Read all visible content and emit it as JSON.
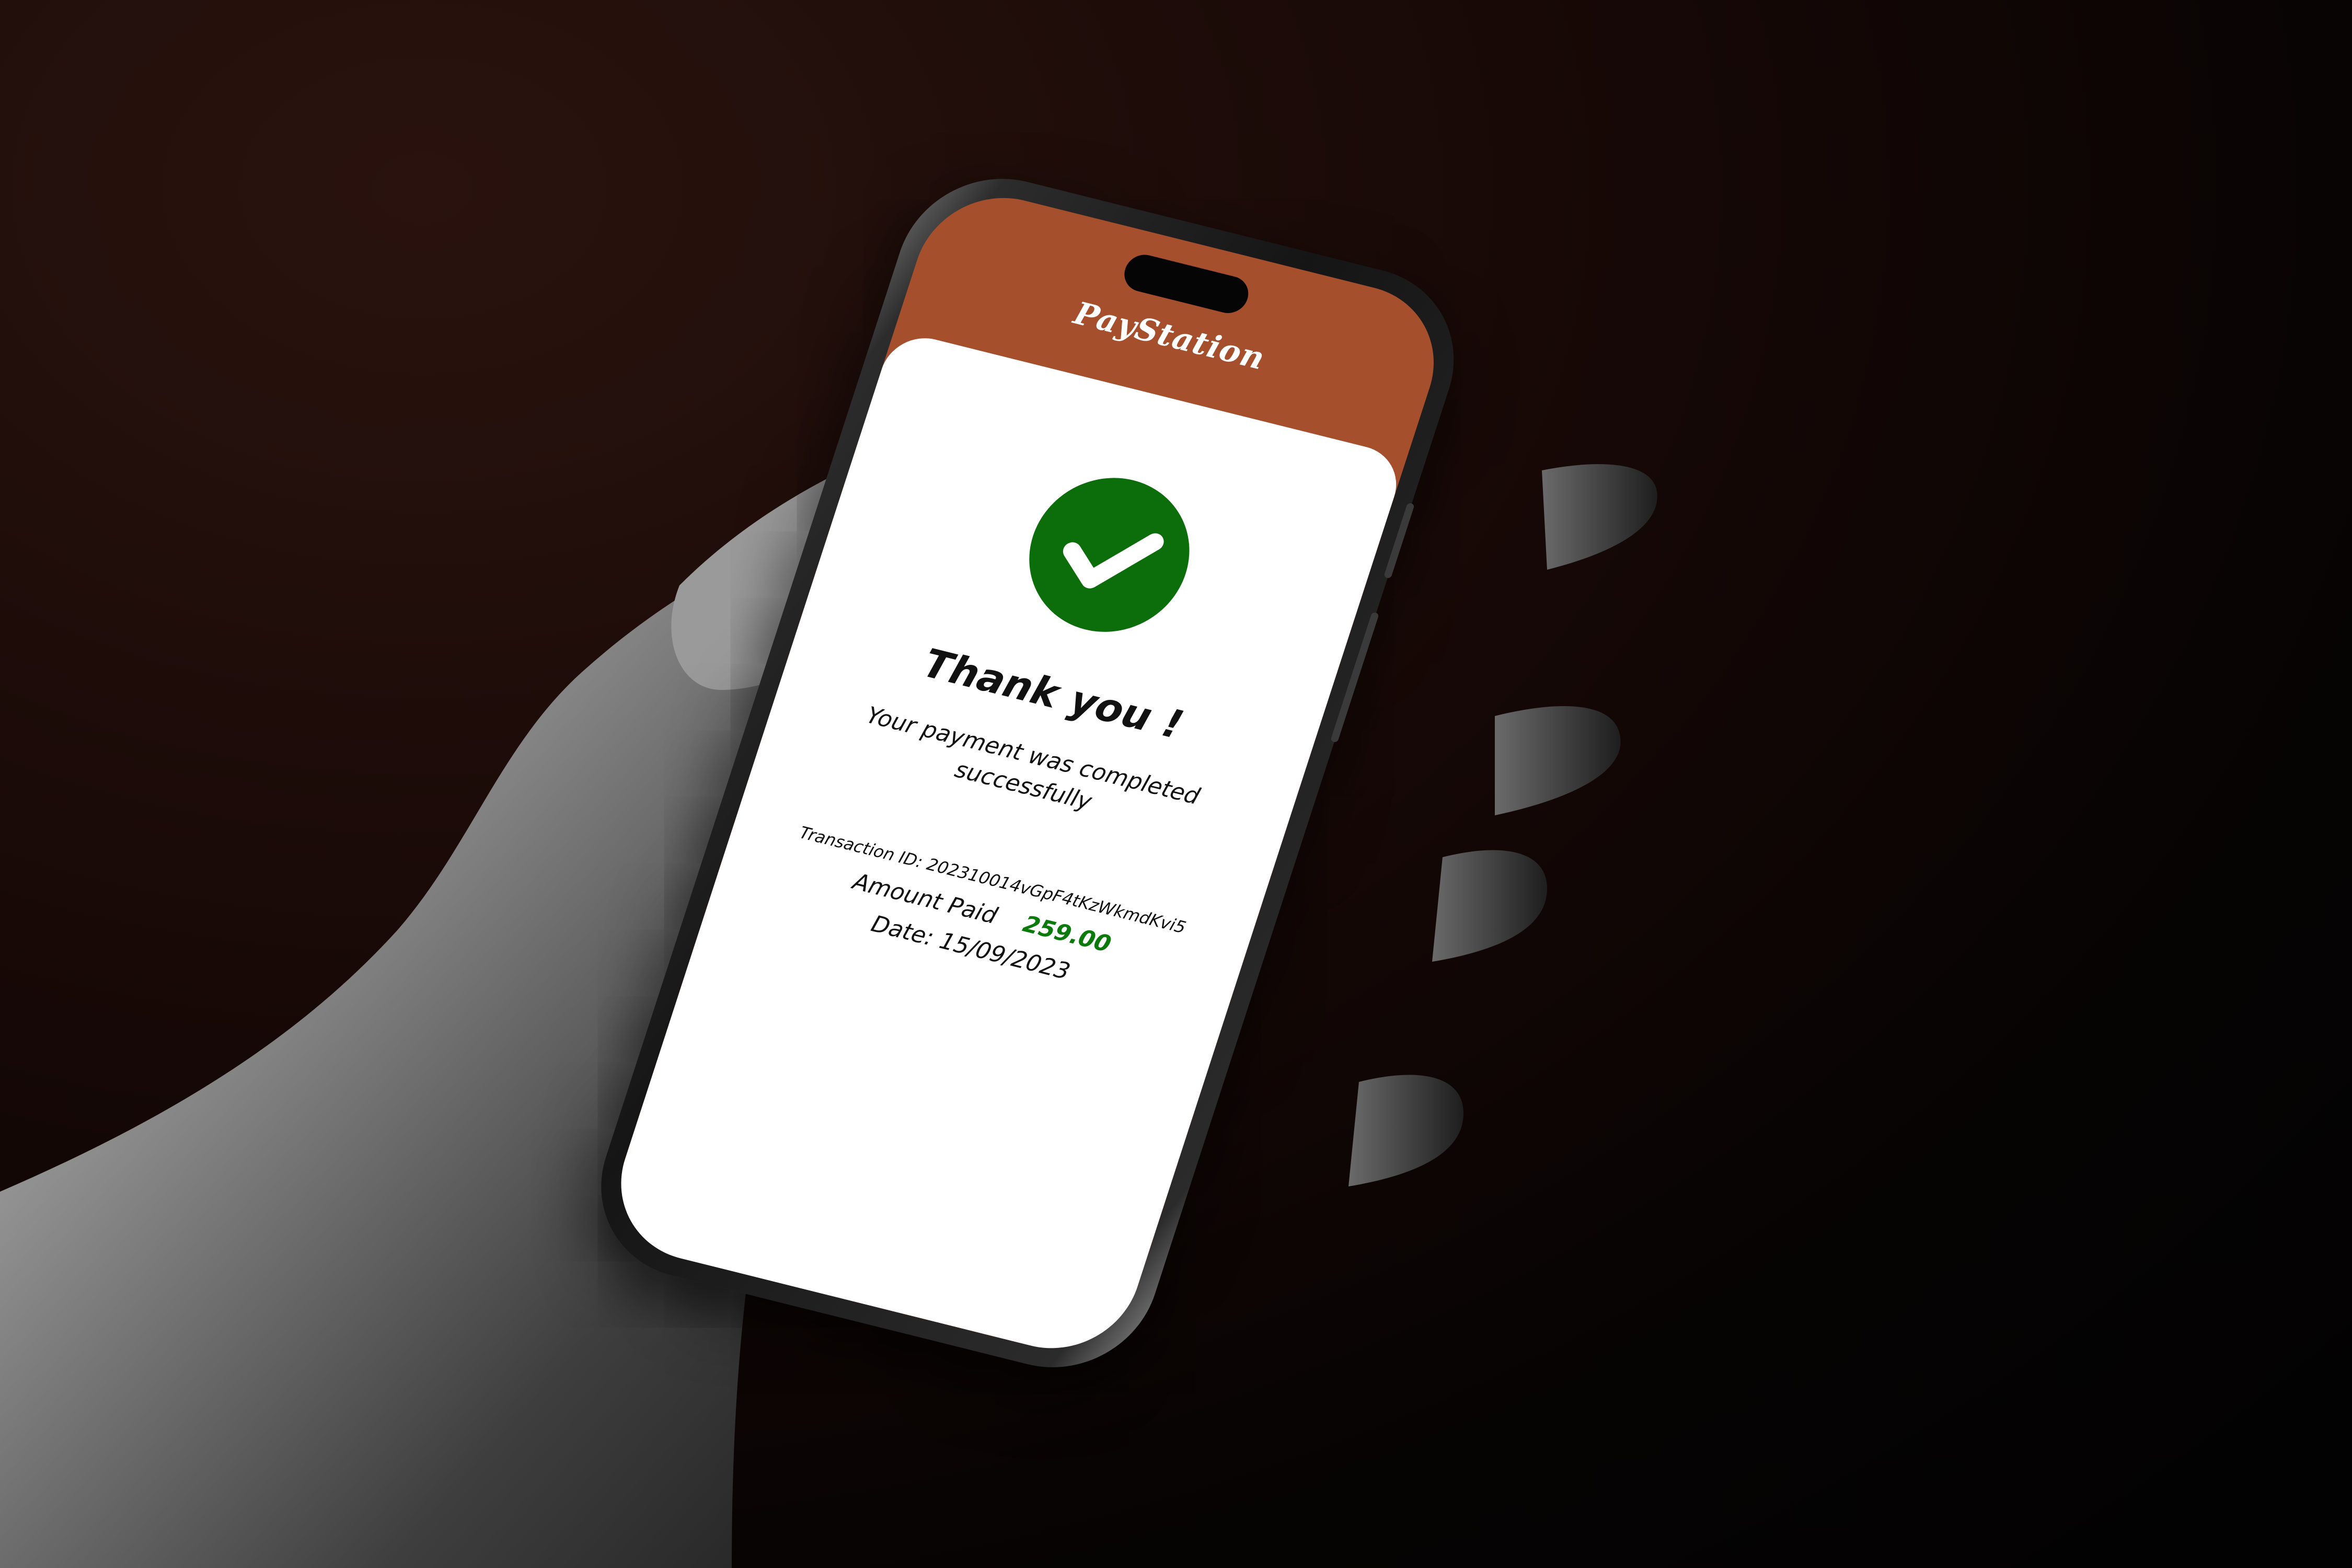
{
  "app": {
    "brand": "PayStation"
  },
  "confirmation": {
    "title": "Thank you !",
    "message": "Your payment was completed successfully",
    "transaction_label": "Transaction ID:",
    "transaction_id": "202310014vGpF4tKzWkmdKvi5",
    "amount_label": "Amount Paid",
    "amount_value": "259.00",
    "date_label": "Date:",
    "date_value": "15/09/2023"
  },
  "colors": {
    "header": "#a64f2d",
    "success": "#0b6e0b",
    "amount": "#0b7a0b"
  },
  "icons": {
    "status": "check-circle-icon"
  }
}
